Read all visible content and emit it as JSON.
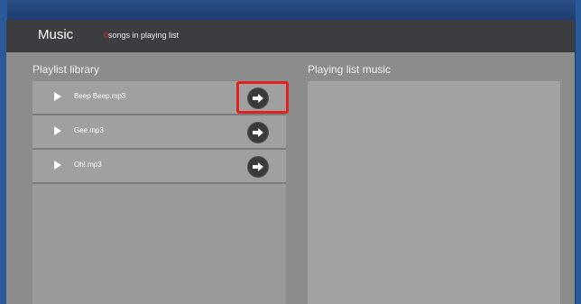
{
  "header": {
    "title": "Music",
    "song_count": "0",
    "song_count_suffix": "songs in playing list"
  },
  "library": {
    "title": "Playlist library",
    "songs": [
      {
        "name": "Beep Beep.mp3"
      },
      {
        "name": "Gee.mp3"
      },
      {
        "name": "Oh!.mp3"
      }
    ]
  },
  "playing": {
    "title": "Playing list music"
  },
  "colors": {
    "accent_red": "#e0211d",
    "titlebar": "#3b3d40",
    "panel": "#8c8c8c"
  },
  "icons": {
    "play": "play-icon",
    "add": "arrow-right-icon"
  }
}
